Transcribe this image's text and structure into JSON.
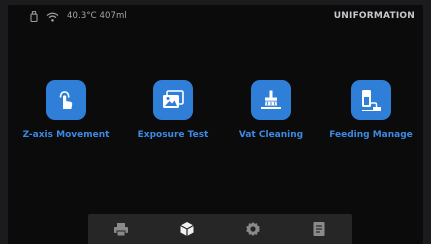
{
  "status": {
    "readout": "40.3°C 407ml"
  },
  "brand": "UNIFORMATION",
  "tiles": [
    {
      "label": "Z-axis Movement",
      "icon": "touch-hand-icon"
    },
    {
      "label": "Exposure Test",
      "icon": "image-frames-icon"
    },
    {
      "label": "Vat Cleaning",
      "icon": "brush-cleaning-icon"
    },
    {
      "label": "Feeding Manage",
      "icon": "resin-feeding-icon"
    }
  ],
  "nav": [
    {
      "icon": "printer-icon",
      "active": false
    },
    {
      "icon": "cube-icon",
      "active": true
    },
    {
      "icon": "gear-icon",
      "active": false
    },
    {
      "icon": "document-icon",
      "active": false
    }
  ],
  "colors": {
    "accent": "#2f7ed8",
    "label": "#3c8ae3",
    "background": "#0b0b0c",
    "nav_background": "#262626",
    "nav_icon": "#8a8a8a",
    "nav_icon_active": "#f0f0f0"
  }
}
